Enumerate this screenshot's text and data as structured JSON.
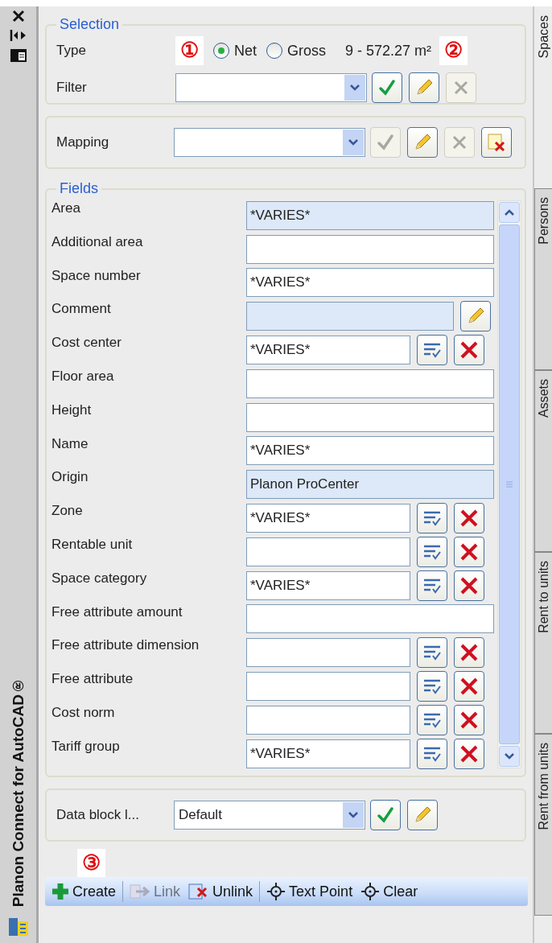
{
  "side_panel": {
    "title": "Planon Connect for AutoCAD®"
  },
  "selection": {
    "legend": "Selection",
    "type_label": "Type",
    "marker_1": "①",
    "radios": [
      {
        "label": "Net",
        "selected": true
      },
      {
        "label": "Gross",
        "selected": false
      }
    ],
    "area_text": "9 - 572.27 m²",
    "marker_2": "②",
    "filter": {
      "label": "Filter",
      "buttons": [
        {
          "kind": "apply",
          "disabled": false
        },
        {
          "kind": "edit",
          "disabled": false
        },
        {
          "kind": "clear",
          "disabled": true
        }
      ]
    }
  },
  "mapping": {
    "label": "Mapping",
    "buttons": [
      {
        "kind": "apply",
        "disabled": true
      },
      {
        "kind": "edit",
        "disabled": false
      },
      {
        "kind": "clear",
        "disabled": true
      },
      {
        "kind": "delete",
        "disabled": false
      }
    ]
  },
  "fields": {
    "legend": "Fields",
    "rows": [
      {
        "label": "Area",
        "value": "*VARIES*",
        "readonly": true,
        "kind": "text"
      },
      {
        "label": "Additional area",
        "readonly": false,
        "kind": "text"
      },
      {
        "label": "Space number",
        "value": "*VARIES*",
        "readonly": false,
        "kind": "text"
      },
      {
        "label": "Comment",
        "readonly": true,
        "kind": "edit"
      },
      {
        "label": "Cost center",
        "value": "*VARIES*",
        "readonly": false,
        "kind": "lookup"
      },
      {
        "label": "Floor area",
        "readonly": false,
        "kind": "text"
      },
      {
        "label": "Height",
        "readonly": false,
        "kind": "text"
      },
      {
        "label": "Name",
        "value": "*VARIES*",
        "readonly": false,
        "kind": "text"
      },
      {
        "label": "Origin",
        "value": "Planon ProCenter",
        "readonly": true,
        "kind": "text"
      },
      {
        "label": "Zone",
        "value": "*VARIES*",
        "readonly": false,
        "kind": "lookup"
      },
      {
        "label": "Rentable unit",
        "readonly": false,
        "kind": "lookup"
      },
      {
        "label": "Space category",
        "value": "*VARIES*",
        "readonly": false,
        "kind": "lookup"
      },
      {
        "label": "Free attribute amount",
        "readonly": false,
        "kind": "text"
      },
      {
        "label": "Free attribute dimension",
        "readonly": false,
        "kind": "lookup"
      },
      {
        "label": "Free attribute",
        "readonly": false,
        "kind": "lookup"
      },
      {
        "label": "Cost norm",
        "readonly": false,
        "kind": "lookup"
      },
      {
        "label": "Tariff group",
        "value": "*VARIES*",
        "readonly": false,
        "kind": "lookup"
      }
    ]
  },
  "data_block": {
    "label": "Data  block l...",
    "value": "Default",
    "buttons": [
      {
        "kind": "apply",
        "disabled": false
      },
      {
        "kind": "edit",
        "disabled": false
      }
    ]
  },
  "marker_3": "③",
  "toolbar": [
    {
      "kind": "create",
      "label": "Create",
      "disabled": false
    },
    {
      "kind": "link",
      "label": "Link",
      "disabled": true
    },
    {
      "kind": "unlink",
      "label": "Unlink",
      "disabled": false
    },
    {
      "kind": "point",
      "label": "Text Point",
      "disabled": false
    },
    {
      "kind": "point",
      "label": "Clear",
      "disabled": false
    }
  ],
  "side_tabs": [
    {
      "label": "Spaces",
      "selected": true
    },
    {
      "label": "Persons",
      "selected": false
    },
    {
      "label": "Assets",
      "selected": false
    },
    {
      "label": "Rent to units",
      "selected": false
    },
    {
      "label": "Rent from units",
      "selected": false
    }
  ]
}
